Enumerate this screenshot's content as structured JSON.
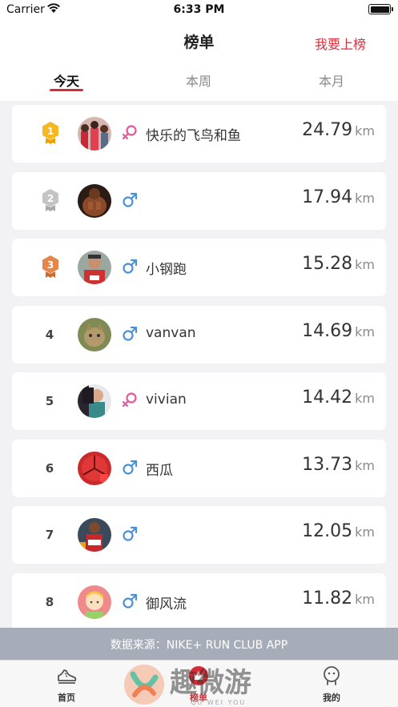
{
  "status_bar": {
    "carrier": "Carrier",
    "time": "6:33 PM"
  },
  "nav": {
    "title": "榜单",
    "action": "我要上榜"
  },
  "tabs": [
    {
      "label": "今天",
      "active": true
    },
    {
      "label": "本周",
      "active": false
    },
    {
      "label": "本月",
      "active": false
    }
  ],
  "unit": "km",
  "entries": [
    {
      "rank": "1",
      "medal": "gold",
      "gender": "female",
      "name": "快乐的飞鸟和鱼",
      "distance": "24.79"
    },
    {
      "rank": "2",
      "medal": "silver",
      "gender": "male",
      "name": "",
      "distance": "17.94"
    },
    {
      "rank": "3",
      "medal": "bronze",
      "gender": "male",
      "name": "小钢跑",
      "distance": "15.28"
    },
    {
      "rank": "4",
      "medal": "",
      "gender": "male",
      "name": "vanvan",
      "distance": "14.69"
    },
    {
      "rank": "5",
      "medal": "",
      "gender": "female",
      "name": "vivian",
      "distance": "14.42"
    },
    {
      "rank": "6",
      "medal": "",
      "gender": "male",
      "name": "西瓜",
      "distance": "13.73"
    },
    {
      "rank": "7",
      "medal": "",
      "gender": "male",
      "name": "",
      "distance": "12.05"
    },
    {
      "rank": "8",
      "medal": "",
      "gender": "male",
      "name": "御风流",
      "distance": "11.82"
    }
  ],
  "source_bar": {
    "text": "数据来源：NIKE+ RUN CLUB APP"
  },
  "tabbar": [
    {
      "label": "首页",
      "icon": "shoe-icon",
      "active": false
    },
    {
      "label": "榜单",
      "icon": "ranking-icon",
      "active": true
    },
    {
      "label": "我的",
      "icon": "profile-icon",
      "active": false
    }
  ],
  "watermark": {
    "text": "趣微游",
    "subtext": "QU WEI YOU"
  },
  "colors": {
    "accent": "#d62c36",
    "male": "#4a90d9",
    "female": "#e8559a",
    "gold": "#f5b823",
    "silver": "#b8b8b8",
    "bronze": "#e5864a"
  }
}
